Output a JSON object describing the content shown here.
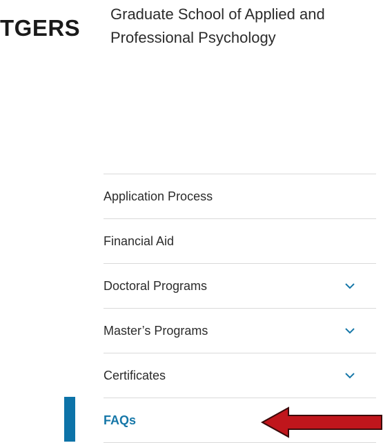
{
  "header": {
    "logo_text": "TGERS",
    "school_name": "Graduate School of Applied and Professional Psychology"
  },
  "nav": {
    "items": [
      {
        "label": "Application Process",
        "expandable": false,
        "active": false
      },
      {
        "label": "Financial Aid",
        "expandable": false,
        "active": false
      },
      {
        "label": "Doctoral Programs",
        "expandable": true,
        "active": false
      },
      {
        "label": "Master’s Programs",
        "expandable": true,
        "active": false
      },
      {
        "label": "Certificates",
        "expandable": true,
        "active": false
      },
      {
        "label": "FAQs",
        "expandable": false,
        "active": true
      }
    ]
  },
  "colors": {
    "accent": "#0d73a8",
    "active_text": "#1677a8",
    "annotation_arrow": "#c0161c",
    "divider": "#d9d9d9"
  },
  "icons": {
    "expand": "chevron-down-icon",
    "annotation": "arrow-left-icon"
  }
}
